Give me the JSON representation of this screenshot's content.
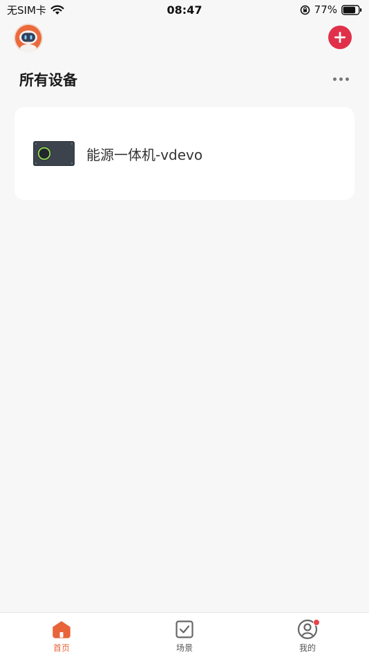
{
  "status_bar": {
    "carrier": "无SIM卡",
    "time": "08:47",
    "battery": "77%"
  },
  "header": {
    "title": "所有设备"
  },
  "devices": [
    {
      "name": "能源一体机-vdevo"
    }
  ],
  "tabs": [
    {
      "label": "首页",
      "icon": "home-icon",
      "active": true
    },
    {
      "label": "场景",
      "icon": "checkbox-icon",
      "active": false
    },
    {
      "label": "我的",
      "icon": "user-icon",
      "active": false,
      "badge": true
    }
  ],
  "colors": {
    "accent": "#e8643a",
    "add_button": "#e0304a",
    "background": "#f7f7f7"
  }
}
